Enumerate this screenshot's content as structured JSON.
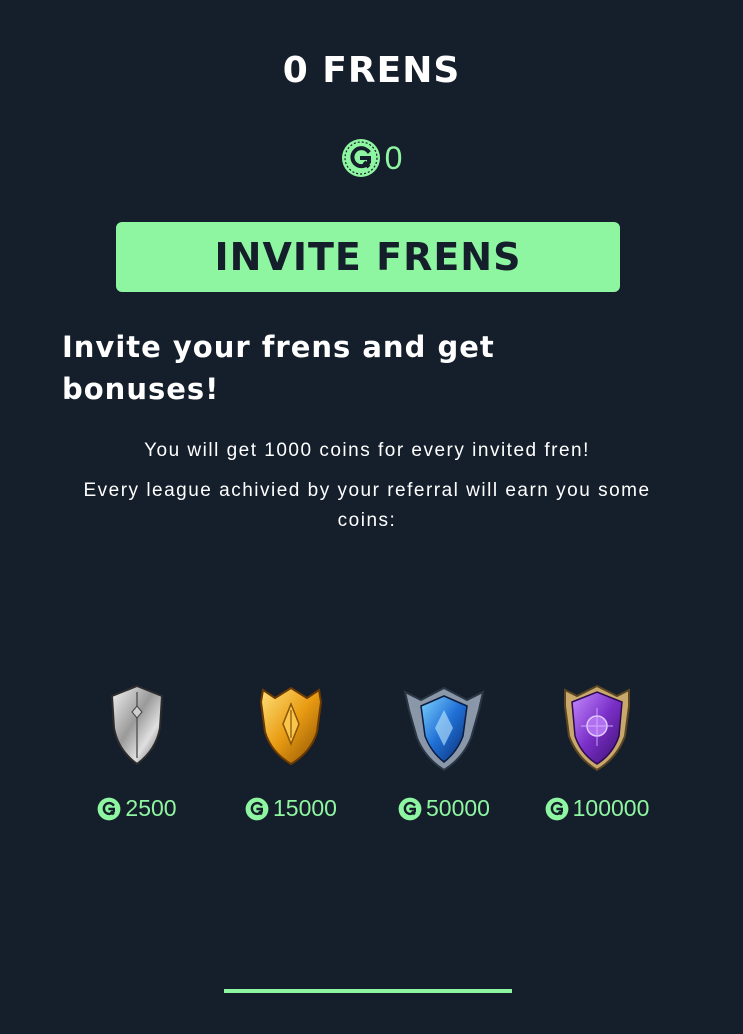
{
  "header": {
    "title": "0 FRENS"
  },
  "balance": {
    "icon": "coin-icon",
    "value": "0"
  },
  "invite_button": {
    "label": "INVITE FRENS"
  },
  "info": {
    "headline": "Invite your frens and get bonuses!",
    "line1": "You will get 1000 coins for every invited fren!",
    "line2": "Every league achivied by your referral will earn you some coins:"
  },
  "leagues": [
    {
      "icon": "silver-shield-icon",
      "reward": "2500"
    },
    {
      "icon": "gold-shield-icon",
      "reward": "15000"
    },
    {
      "icon": "blue-shield-icon",
      "reward": "50000"
    },
    {
      "icon": "purple-shield-icon",
      "reward": "100000"
    }
  ],
  "colors": {
    "background": "#151e2b",
    "accent": "#8ef5a1",
    "text": "#ffffff"
  }
}
